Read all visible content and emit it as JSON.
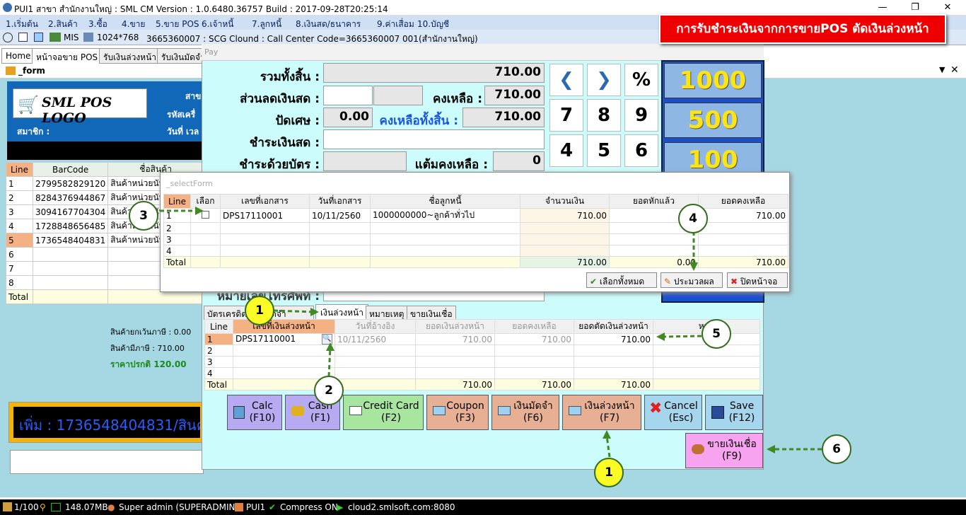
{
  "window": {
    "title": "PUI1 สาขา สำนักงานใหญ่ : SML CM Version : 1.0.6480.36757 Build : 2017-09-28T20:25:14"
  },
  "menu": [
    "1.เริ่มต้น",
    "2.สินค้า",
    "3.ซื้อ",
    "4.ขาย",
    "5.ขาย POS",
    "6.เจ้าหนี้",
    "7.ลูกหนี้",
    "8.เงินสด/ธนาคาร",
    "9.ค่าเสื่อม",
    "10.บัญชี"
  ],
  "toolbar": {
    "mis": "MIS",
    "resolution": "1024*768",
    "info": "3665360007 : SCG Clound : Call Center Code=3665360007 001(สำนักงานใหญ่)"
  },
  "tabs": [
    "Home",
    "หน้าจอขาย POS",
    "รับเงินล่วงหน้า",
    "รับเงินมัดจำ"
  ],
  "form_title": "_form",
  "banner": "การรับชำระเงินจากการขายPOS ตัดเงินล่วงหน้า",
  "left": {
    "logo": "SML POS LOGO",
    "branch_lbl": "สาข",
    "machine_lbl": "รหัสเครื่",
    "member_lbl": "สมาชิก :",
    "date_lbl": "วันที่ เวล",
    "headers": [
      "Line",
      "BarCode",
      "ชื่อสินค้า"
    ],
    "rows": [
      {
        "line": "1",
        "barcode": "2799582829120",
        "name": "สินค้าหน่วยนับเ"
      },
      {
        "line": "2",
        "barcode": "8284376944867",
        "name": "สินค้าหน่วยนับเ"
      },
      {
        "line": "3",
        "barcode": "3094167704304",
        "name": "สินค้าหน่วยนับเ"
      },
      {
        "line": "4",
        "barcode": "1728848656485",
        "name": "สินค้าหน่วยนับเ"
      },
      {
        "line": "5",
        "barcode": "1736548404831",
        "name": "สินค้าหน่วยนับเ"
      },
      {
        "line": "6",
        "barcode": "",
        "name": ""
      },
      {
        "line": "7",
        "barcode": "",
        "name": ""
      },
      {
        "line": "8",
        "barcode": "",
        "name": ""
      }
    ],
    "total": "Total",
    "non_vat": "สินค้ายกเว้นภาษี : 0.00",
    "vat": "สินค้ามีภาษี : 710.00",
    "normal_price": "ราคาปรกติ 120.00",
    "scroll_text": "เพิ่ม : 1736548404831/สินค้"
  },
  "pay": {
    "title": "Pay",
    "total_lbl": "รวมทั้งสิ้น :",
    "total": "710.00",
    "discount_lbl": "ส่วนลดเงินสด :",
    "remain_lbl": "คงเหลือ :",
    "remain": "710.00",
    "round_lbl": "ปัดเศษ :",
    "round": "0.00",
    "net_lbl": "คงเหลือทั้งสิ้น :",
    "net": "710.00",
    "cash_lbl": "ชำระเงินสด :",
    "card_lbl": "ชำระด้วยบัตร :",
    "points_lbl": "แต้มคงเหลือ :",
    "points": "0",
    "phone_lbl": "หมายเลขโทรศัพท์ :",
    "keys": [
      "%",
      "7",
      "8",
      "9",
      "4",
      "5",
      "6"
    ],
    "notes": [
      "1000",
      "500",
      "100"
    ],
    "subtabs": [
      "บัตรเครดิต",
      "เงินมัดจำ",
      "เงินล่วงหน้า",
      "หมายเหตุ",
      "ขายเงินเชื่อ"
    ],
    "adv_headers": [
      "Line",
      "เลขที่เงินล่วงหน้า",
      "วันที่อ้างอิง",
      "ยอดเงินล่วงหน้า",
      "ยอดคงเหลือ",
      "ยอดตัดเงินล่วงหน้า",
      "หมา"
    ],
    "adv_row": {
      "line": "1",
      "doc": "DPS17110001",
      "date": "10/11/2560",
      "amount": "710.00",
      "balance": "710.00",
      "cut": "710.00"
    },
    "adv_lines": [
      "2",
      "3",
      "4"
    ],
    "adv_total": {
      "label": "Total",
      "amount": "710.00",
      "balance": "710.00",
      "cut": "710.00"
    },
    "buttons": [
      {
        "label": "Calc",
        "key": "(F10)"
      },
      {
        "label": "Cash",
        "key": "(F1)"
      },
      {
        "label": "Credit Card",
        "key": "(F2)"
      },
      {
        "label": "Coupon",
        "key": "(F3)"
      },
      {
        "label": "เงินมัดจำ",
        "key": "(F6)"
      },
      {
        "label": "เงินล่วงหน้า",
        "key": "(F7)"
      },
      {
        "label": "Cancel",
        "key": "(Esc)"
      },
      {
        "label": "Save",
        "key": "(F12)"
      }
    ],
    "credit_sale": {
      "label": "ขายเงินเชื่อ",
      "key": "(F9)"
    }
  },
  "select": {
    "title": "_selectForm",
    "headers": [
      "Line",
      "เลือก",
      "เลขที่เอกสาร",
      "วันที่เอกสาร",
      "ชื่อลูกหนี้",
      "จำนวนเงิน",
      "ยอดหักแล้ว",
      "ยอดคงเหลือ"
    ],
    "row": {
      "line": "1",
      "doc": "DPS17110001",
      "date": "10/11/2560",
      "customer": "1000000000~ลูกค้าทั่วไป",
      "amount": "710.00",
      "deducted": "",
      "balance": "710.00"
    },
    "lines": [
      "2",
      "3",
      "4"
    ],
    "total": {
      "label": "Total",
      "amount": "710.00",
      "deducted": "0.00",
      "balance": "710.00"
    },
    "btn_all": "เลือกทั้งหมด",
    "btn_process": "ประมวลผล",
    "btn_close": "ปิดหน้าจอ"
  },
  "callouts": [
    "1",
    "2",
    "3",
    "4",
    "5",
    "6",
    "1"
  ],
  "status": {
    "rec": "1/100",
    "mem": "148.07MB",
    "user": "Super admin (SUPERADMIN)",
    "db": "PUI1",
    "compress": "Compress ON",
    "server": "cloud2.smlsoft.com:8080"
  }
}
